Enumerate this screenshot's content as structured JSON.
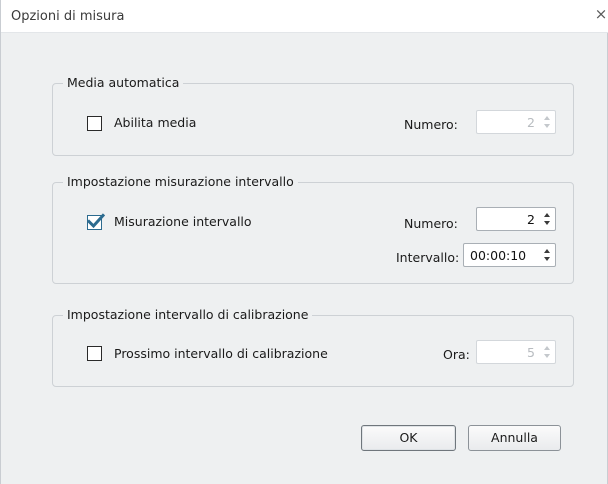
{
  "window": {
    "title": "Opzioni di misura",
    "close_glyph": "×"
  },
  "media_automatica": {
    "legend": "Media automatica",
    "checkbox_label": "Abilita media",
    "checked": false,
    "numero_label": "Numero:",
    "numero_value": "2",
    "enabled": false
  },
  "misurazione_intervallo": {
    "legend": "Impostazione misurazione intervallo",
    "checkbox_label": "Misurazione intervallo",
    "checked": true,
    "numero_label": "Numero:",
    "numero_value": "2",
    "intervallo_label": "Intervallo:",
    "intervallo_value": "00:00:10",
    "enabled": true
  },
  "intervallo_calibrazione": {
    "legend": "Impostazione intervallo di calibrazione",
    "checkbox_label": "Prossimo intervallo di calibrazione",
    "checked": false,
    "ora_label": "Ora:",
    "ora_value": "5",
    "enabled": false
  },
  "buttons": {
    "ok": "OK",
    "cancel": "Annulla"
  },
  "colors": {
    "accent": "#2c6b8f",
    "dialog_bg": "#eef0f1",
    "disabled_text": "#b8bcc0"
  }
}
